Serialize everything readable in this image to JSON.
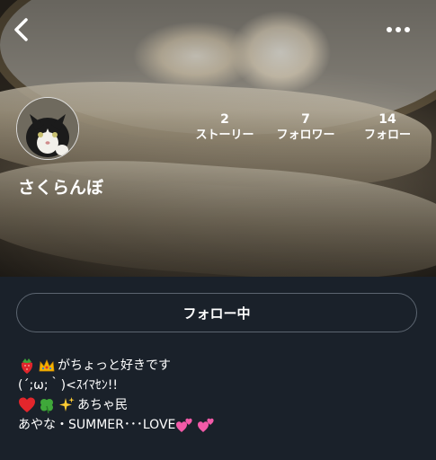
{
  "profile": {
    "username": "さくらんぼ",
    "stats": [
      {
        "value": "2",
        "label": "ストーリー"
      },
      {
        "value": "7",
        "label": "フォロワー"
      },
      {
        "value": "14",
        "label": "フォロー"
      }
    ],
    "follow_button_label": "フォロー中"
  },
  "bio": {
    "line1_text": "がちょっと好きです",
    "line2_text": "(´;ω;｀)<ｽｲﾏｾﾝ!!",
    "line3_text": "あちゃ民",
    "line4_text": "あやな・SUMMER･･･LOVE"
  },
  "icons": {
    "back": "back-chevron-icon",
    "more": "more-dots-icon",
    "strawberry": "strawberry-icon",
    "crown": "crown-icon",
    "heart": "red-heart-icon",
    "clover": "clover-icon",
    "sparkles": "sparkles-icon",
    "pink_hearts": "two-hearts-icon"
  },
  "colors": {
    "background": "#1a212a",
    "button_border": "#5c6570",
    "text": "#ffffff"
  }
}
